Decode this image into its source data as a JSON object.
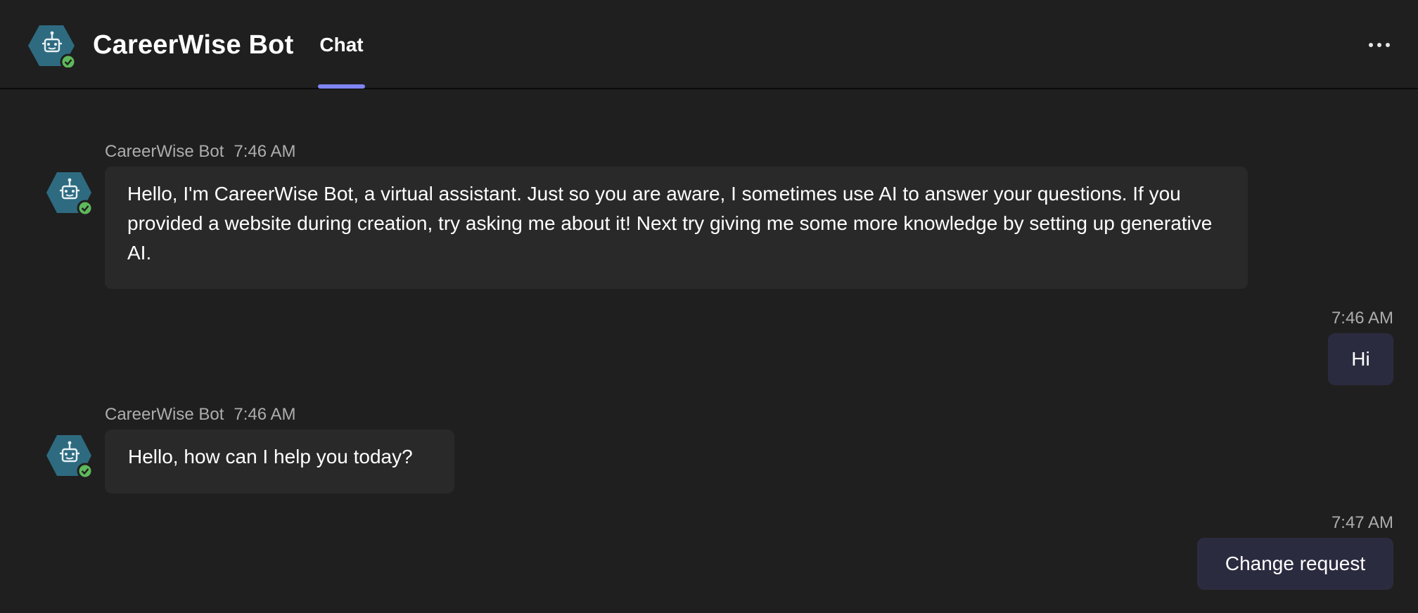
{
  "header": {
    "title": "CareerWise Bot",
    "tab_label": "Chat",
    "accent_color": "#7f85f5",
    "avatar_color": "#2e6b80",
    "status_color": "#5fb85b",
    "more_icon": "more-horizontal-icon"
  },
  "messages": [
    {
      "from": "bot",
      "sender": "CareerWise Bot",
      "time": "7:46 AM",
      "text": "Hello, I'm CareerWise Bot, a virtual assistant. Just so you are aware, I sometimes use AI to answer your questions. If you provided a website during creation, try asking me about it! Next try giving me some more knowledge by setting up generative AI."
    },
    {
      "from": "user",
      "time": "7:46 AM",
      "text": "Hi"
    },
    {
      "from": "bot",
      "sender": "CareerWise Bot",
      "time": "7:46 AM",
      "text": "Hello, how can I help you today?"
    },
    {
      "from": "user",
      "time": "7:47 AM",
      "text": "Change request"
    }
  ]
}
